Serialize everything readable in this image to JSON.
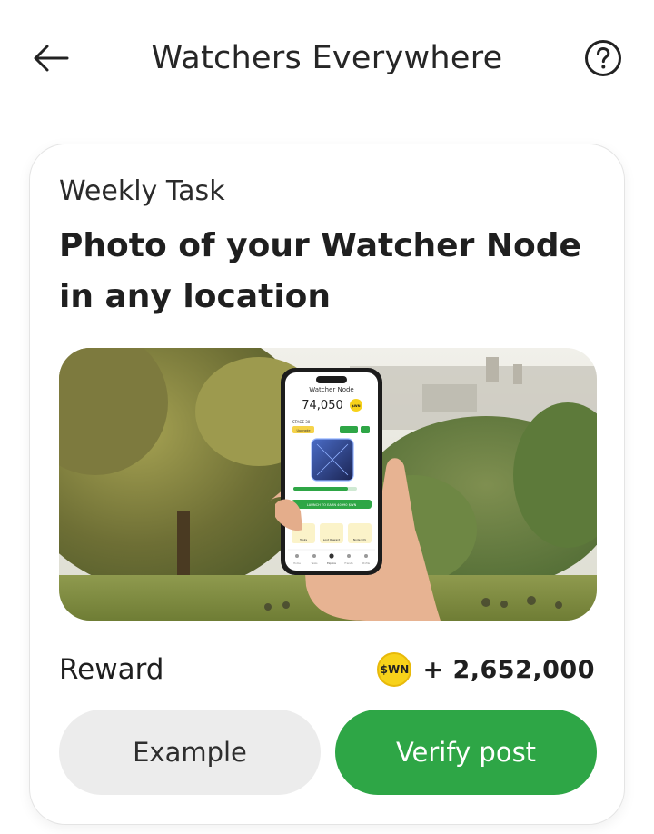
{
  "header": {
    "title": "Watchers Everywhere",
    "back_icon": "arrow-left-icon",
    "help_icon": "question-circle-icon"
  },
  "task": {
    "label": "Weekly Task",
    "title": "Photo of your Watcher Node in any location"
  },
  "image": {
    "phone": {
      "screen_title": "Watcher Node",
      "balance": "74,050",
      "coin_label": "$WN",
      "stage": "STAGE 30",
      "upgrade_label": "Upgrade",
      "cta": "LAUNCH TO EARN 40990 $WN",
      "tabs": [
        "Tasks",
        "Loot Reward",
        "Node Info"
      ],
      "nav": [
        "Home",
        "Tasks",
        "Explore",
        "Friends",
        "Profile"
      ]
    }
  },
  "reward": {
    "label": "Reward",
    "coin_label": "$WN",
    "amount": "+ 2,652,000"
  },
  "buttons": {
    "example_label": "Example",
    "verify_label": "Verify post"
  },
  "colors": {
    "primary_green": "#2ea646",
    "secondary_gray": "#ececec",
    "coin_yellow": "#f7d21a"
  }
}
